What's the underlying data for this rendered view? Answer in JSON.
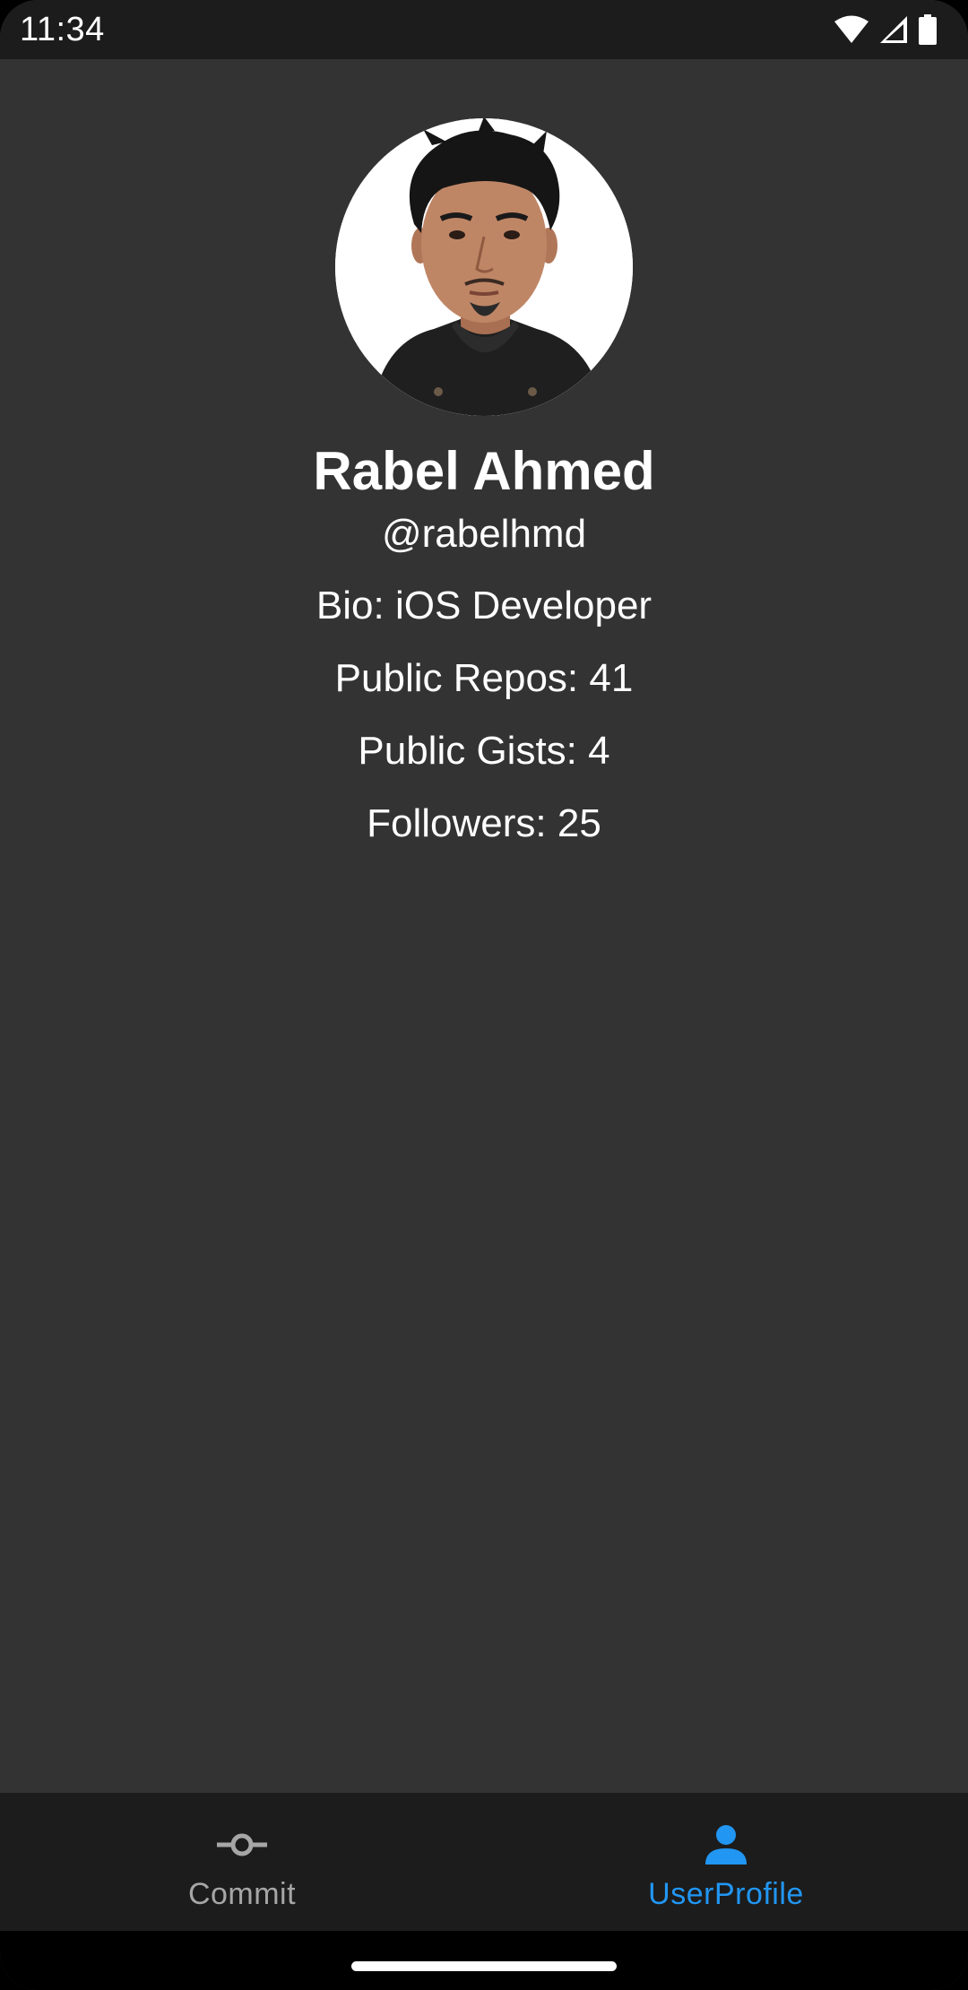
{
  "status_bar": {
    "time": "11:34",
    "icons": [
      "wifi-icon",
      "cell-signal-icon",
      "battery-icon"
    ]
  },
  "profile": {
    "avatar": "profile-photo",
    "name": "Rabel Ahmed",
    "handle": "@rabelhmd",
    "bio": "Bio: iOS Developer",
    "public_repos": "Public Repos: 41",
    "public_gists": "Public Gists: 4",
    "followers": "Followers: 25"
  },
  "bottom_nav": {
    "items": [
      {
        "label": "Commit",
        "icon": "commit-icon",
        "active": false
      },
      {
        "label": "UserProfile",
        "icon": "person-icon",
        "active": true
      }
    ]
  },
  "colors": {
    "background": "#333333",
    "bar_background": "#1c1c1c",
    "accent": "#2196f3",
    "inactive": "#a6a6a6",
    "text": "#ffffff"
  }
}
